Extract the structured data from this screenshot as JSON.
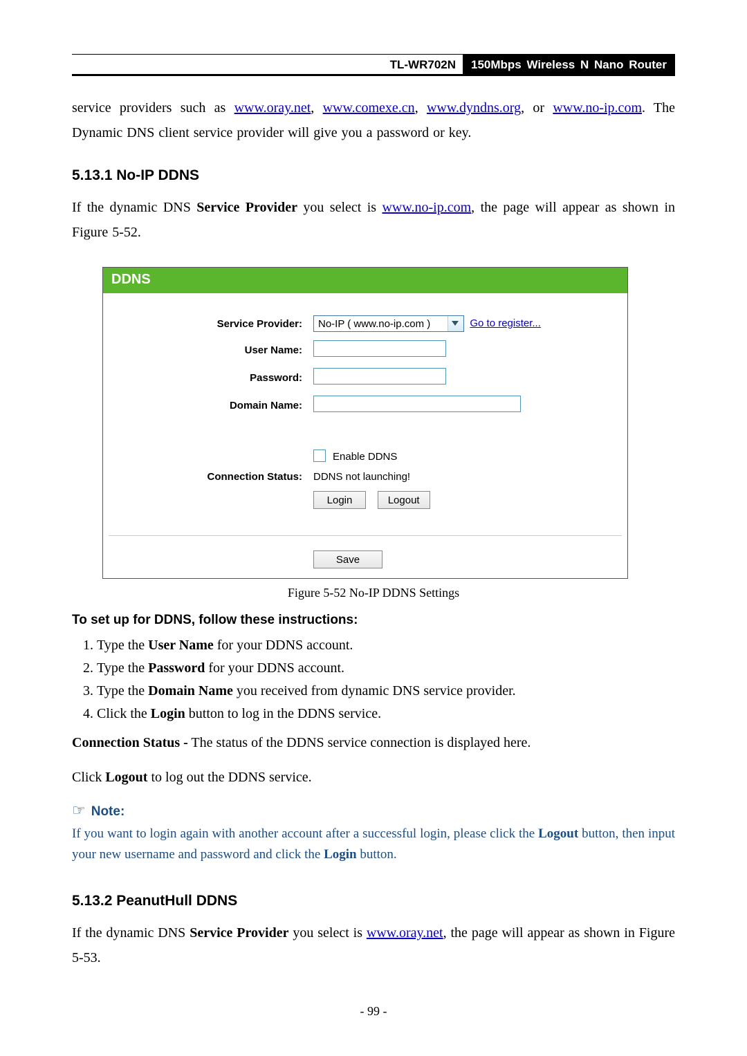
{
  "header": {
    "model": "TL-WR702N",
    "tagline": "150Mbps Wireless N Nano Router"
  },
  "intro": {
    "pre": "service providers such as ",
    "links": [
      {
        "text": "www.oray.net"
      },
      {
        "text": "www.comexe.cn"
      },
      {
        "text": "www.dyndns.org"
      },
      {
        "text": "www.no-ip.com"
      }
    ],
    "sep": ", ",
    "or": ", or ",
    "post": ". The Dynamic DNS client service provider will give you a password or key."
  },
  "sec1": {
    "heading": "5.13.1  No-IP DDNS",
    "p_pre": "If the dynamic DNS ",
    "p_b1": "Service Provider",
    "p_mid": " you select is ",
    "p_link": "www.no-ip.com",
    "p_post": ", the page will appear as shown in Figure 5-52."
  },
  "panel": {
    "title": "DDNS",
    "labels": {
      "sp": "Service Provider:",
      "un": "User Name:",
      "pw": "Password:",
      "dn": "Domain Name:",
      "cs": "Connection Status:"
    },
    "sp_value": "No-IP ( www.no-ip.com )",
    "register": "Go to register...",
    "enable": "Enable DDNS",
    "status": "DDNS not launching!",
    "login": "Login",
    "logout": "Logout",
    "save": "Save"
  },
  "figcap": "Figure 5-52 No-IP DDNS Settings",
  "inst_head": "To set up for DDNS, follow these instructions:",
  "inst": [
    {
      "a": "Type the ",
      "b": "User Name",
      "c": " for your DDNS account."
    },
    {
      "a": "Type the ",
      "b": "Password",
      "c": " for your DDNS account."
    },
    {
      "a": "Type the ",
      "b": "Domain Name",
      "c": " you received from dynamic DNS service provider."
    },
    {
      "a": "Click the ",
      "b": "Login",
      "c": " button to log in the DDNS service."
    }
  ],
  "conn": {
    "b": "Connection Status -",
    "t": " The status of the DDNS service connection is displayed here."
  },
  "logout_line": {
    "a": "Click ",
    "b": "Logout",
    "c": " to log out the DDNS service."
  },
  "note": {
    "head": "Note:",
    "body_a": "If you want to login again with another account after a successful login, please click the ",
    "body_b1": "Logout",
    "body_mid": " button, then input your new username and password and click the ",
    "body_b2": "Login",
    "body_end": " button."
  },
  "sec2": {
    "heading": "5.13.2  PeanutHull DDNS",
    "p_pre": "If the dynamic DNS ",
    "p_b1": "Service Provider",
    "p_mid": " you select is ",
    "p_link": "www.oray.net",
    "p_post": ", the page will appear as shown in Figure 5-53."
  },
  "page_number": "- 99 -"
}
